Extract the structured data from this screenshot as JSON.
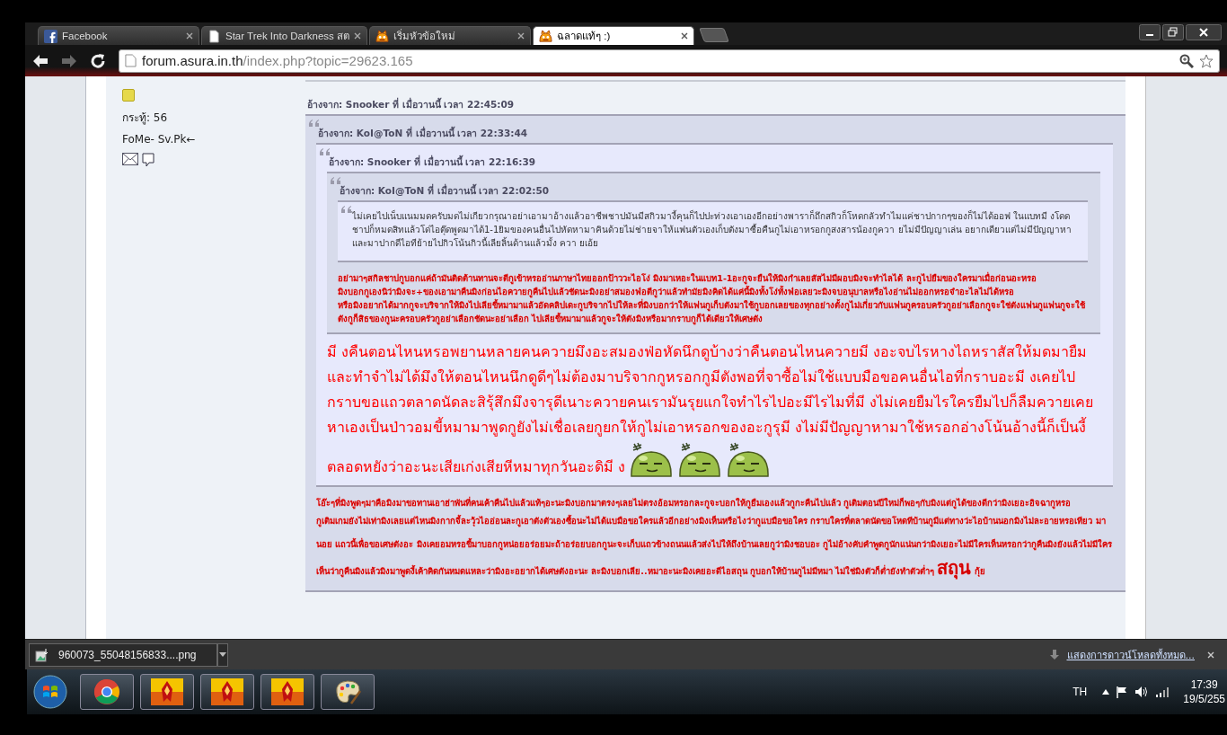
{
  "tabs": [
    {
      "title": "Facebook",
      "kind": "facebook",
      "selected": false
    },
    {
      "title": "Star Trek Into Darkness สต",
      "kind": "page",
      "selected": false
    },
    {
      "title": "เริ่มหัวข้อใหม่",
      "kind": "mascot",
      "selected": false
    },
    {
      "title": "ฉลาดแท้ๆ :)",
      "kind": "mascot",
      "selected": true
    }
  ],
  "nav_buttons": [
    {
      "kind": "back",
      "disabled": false
    },
    {
      "kind": "forward",
      "disabled": true
    },
    {
      "kind": "reload",
      "disabled": false
    }
  ],
  "url": {
    "host": "forum.asura.in.th",
    "path": "/index.php?topic=29623.165"
  },
  "poster": {
    "posts": "กระทู้: 56",
    "signature": "FoMe- Sv.Pk←"
  },
  "quote": {
    "header": "อ้างจาก: Snooker ที่ เมื่อวานนี้ เวลา 22:45:09",
    "quote": {
      "header": "อ้างจาก: KoI@ToN ที่ เมื่อวานนี้ เวลา 22:33:44",
      "quote": {
        "header": "อ้างจาก: Snooker ที่ เมื่อวานนี้ เวลา 22:16:39",
        "quote": {
          "header": "อ้างจาก: KoI@ToN ที่ เมื่อวานนี้ เวลา 22:02:50",
          "body": {
            "kind": "plain",
            "paragraphs": [
              "ไม่เคยไปเน็บแนมมดครับมดไม่เกียวกรุณาอย่าเอามาอ้างแล้วอาชีพชาปมันมีสกิวมางี้คุนก็ไปปะท่วงเอาเองอีกอย่างพาราก็ถึกสกิวก็โหดกลัวทำไมแค่ชาปกากๆของก็ไม่ได้ออฟ ในแบทมี งโดดชาปก็หมดสิทแล้วโด่ไอตุ๊ดพูดมาได้1-1ยิมของคนอื่นไปหัดหามาคินด้วยไม่ช่ายจาให้แฟนตัวเองเก็บตังมาซื้อคืนกูไม่เอาหรอกกูสงสารน้องกูควา ยไม่มีปัญญาเล่น อยากเดียวแต่ไม่มีปัญญาหาและมาปากดีไอทีย้ายไปกิวโน้นกิวนี้เลียลิ้นด้านแล้วมั้ง ควา ยเอ้ย"
            ]
          }
        },
        "body": {
          "kind": "bold-red",
          "paragraphs": [
            "อย่ามาๆสกิลชาปกูบอกแค่ถ้ามันติดต้านทานจะตีกูเข้าหรออ่านภาษาไทยออกป้าววะไอโง่ มิงมาเหอะในแบท1-1อะกูจะยืนให้มิงกำเลยสัสไม่มีผอบมิงจะทำไลได้ ละกูไปยืมของใครมาเมื่อก่อนอะหรอ",
            "มิงบอกกูเองนิว่ามิงจะ+ของเอามาคืนมิงก่อนไอควายกูคืนไปแล้วชัดนะมิงอย่าสมองฟ่อตีกูว่าแล้วทำมัยมิงคิดได้แค่นี้มิงทั้งโง่ทั้งฟ่อเลยวะมิงจบอนุบาลหรือไงอ่านไม่ออกหรอจำอะไลไม่ได้หรอ",
            "หรือมิงอยากได้มากกูจะบริจากให้มิงไปเลียขี้หมามาแล้วอัดคลิปเดะกูบริจากไปให้ละที่มิงบอกว่าให้แฟนกูเก็บตังมาใช้กูบอกเลยของทุกอย่างตั้งกูไม่เกี่ยวกับแฟนกูครอบครัวกูอย่าเลือกกูจะใช่ตังแฟนกูแฟนกูจะใช้ตังกูก็สิธของกูนะครอบครัวกูอย่าเลือกชัดนะอย่าเลือก ไปเลียขี้หมามาแล้วกูจะให้ตังมิงหรือมากราบกูก็ได้เดียวให้เศษตัง"
          ]
        }
      },
      "body": {
        "kind": "large-red",
        "paragraphs": [
          "มี งคืนตอนไหนหรอพยานหลายคนควายมึงอะสมองฟ่อหัดนึกดูบ้างว่าคืนตอนไหนควายมี งอะจบไรหางไถหราสัสให้มดมายืมและทำจำไม่ได้มึงให้ตอนไหนนึกดูดีๆไม่ต้องมาบริจากกูหรอกกูมีตังพอที่จาซื้อไม่ใช้แบบมือขอคนอื่นไอที่กราบอะมี งเคยไปกราบขอแถวตลาดนัดละสิรุ้สึกมึงจารุดีเนาะควายคนเรามันรุยแกใจทำไรไปอะมีไรไมที่มี งไม่เคยยืมไรใครยืมไปก็ลืมควายเคยหาเองเป็นป่าวอมขี้หมามาพูดกูยังไม่เชื่อเลยกูยกให้กูไม่เอาหรอกของอะกูรุมี งไม่มีปัญญาหามาใช้หรอกอ่างโน้นอ้างนี้ก็เป็นงี้ตลอดหยังว่าอะนะเสียเก่งเสียหีหมาทุกวันอะดิมี ง"
        ],
        "emoticons": [
          {
            "kind": "slime"
          },
          {
            "kind": "slime"
          },
          {
            "kind": "slime"
          }
        ]
      }
    },
    "body": {
      "kind": "bold-red",
      "paragraphs": [
        "โอ๊ะๆที่มิงพูดๆมาคือมิงมาขอทานเอาฮ่าพันที่คนเค้าคืนไปแล้วแท้ๆอะนะมิงบอกมาตรงๆเลยไม่ตรงอ้อมหรอกละกูจะบอกให้กูยืมเองแล้วกูกะคืนไปแล้ว กูเติมตอนปีใหม่ก็พอๆกับมิงแต่กูได้ของดีกว่ามิงเยอะอิจฉากูหรอ"
      ],
      "closing": {
        "text": "กูเติมเกมยังไม่เท่ามิงเลยแต่ไหนมิงกากจี้ละวุ้วไออ่อนละกูเอาตังตัวเองซื้อนะไม่ได้แบมือขอใครแล้วอีกอย่างมิงเห็นหรือไงว่ากูแบมือขอใคร กราบใครที่ตลาดนัดขอโหดทีบ้านกูมีแต่ทางว่ะไอบ้านนอกมิงไม่ละอายหรอเทียว มา นอย แถวนี้เพื่อขอเศษตังอะ มิงเคยอมหรอขี้มาบอกกูหน่อยอร่อยมะถ้าอร่อยบอกกูนะจะเก็บแถวข้างถนนแล้วส่งไปให้ถึงบ้านเลยกูว่ามิงชอบอะ กูไม่อ้างคับคำพูดกูนักแน่นกว่ามิงเยอะไม่มีใครเห็นหรอกว่ากูคืนมิงยังแล้วไม่มีใครเห็นว่ากูคืนมิงแล้วมิงมาพูดงี้เค้าคิดกันหมดแหละว่ามิงอะอยากได้เศษตังอะนะ ละมิงบอกเลีย..หมาอะนะมิงเคยอะดีไอสถุน กูบอกให้บ้านกูไม่มีหมา ไม่ใช่มิงตัวก็ต่ำยังทำตัวต่ำๆ",
        "emphasis": "สถุน",
        "tail": "กุ้ย"
      }
    }
  },
  "download": {
    "file": "960073_55048156833....png",
    "show_all": "แสดงการดาวน์โหลดทั้งหมด..."
  },
  "taskbar": {
    "apps": [
      {
        "kind": "chrome"
      },
      {
        "kind": "emblem"
      },
      {
        "kind": "emblem"
      },
      {
        "kind": "emblem"
      },
      {
        "kind": "paint"
      }
    ],
    "language": "TH",
    "time": "17:39",
    "date": "19/5/255"
  }
}
